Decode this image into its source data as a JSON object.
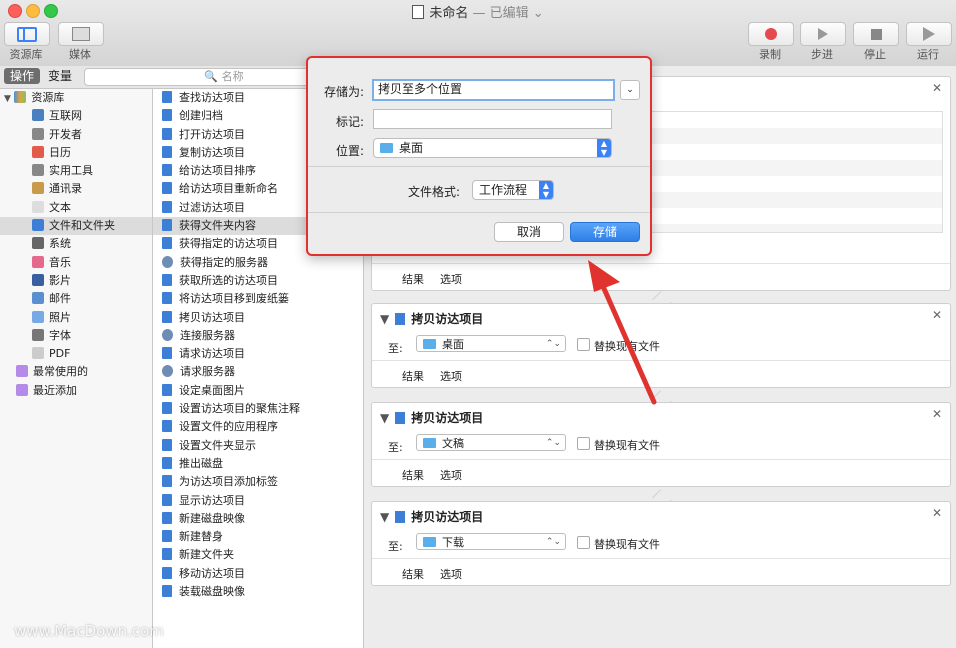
{
  "window": {
    "title": "未命名",
    "subtitle": "— 已编辑 ⌄"
  },
  "toolbar": {
    "library_label": "资源库",
    "media_label": "媒体",
    "record_label": "录制",
    "step_label": "步进",
    "stop_label": "停止",
    "run_label": "运行"
  },
  "tabs": {
    "actions": "操作",
    "variables": "变量",
    "search_placeholder": "名称"
  },
  "library": {
    "root": "资源库",
    "items": [
      "互联网",
      "开发者",
      "日历",
      "实用工具",
      "通讯录",
      "文本",
      "文件和文件夹",
      "系统",
      "音乐",
      "影片",
      "邮件",
      "照片",
      "字体",
      "PDF"
    ],
    "selected_index": 6,
    "smart": [
      "最常使用的",
      "最近添加"
    ]
  },
  "actions": [
    "查找访达项目",
    "创建归档",
    "打开访达项目",
    "复制访达项目",
    "给访达项目排序",
    "给访达项目重新命名",
    "过滤访达项目",
    "获得文件夹内容",
    "获得指定的访达项目",
    "获得指定的服务器",
    "获取所选的访达项目",
    "将访达项目移到废纸篓",
    "拷贝访达项目",
    "连接服务器",
    "请求访达项目",
    "请求服务器",
    "设定桌面图片",
    "设置访达项目的聚焦注释",
    "设置文件的应用程序",
    "设置文件夹显示",
    "推出磁盘",
    "为访达项目添加标签",
    "显示访达项目",
    "新建磁盘映像",
    "新建替身",
    "新建文件夹",
    "移动访达项目",
    "装载磁盘映像"
  ],
  "actions_selected_index": 7,
  "workflow": {
    "card_common": {
      "to_label": "至:",
      "replace_label": "替换现有文件",
      "results": "结果",
      "options": "选项"
    },
    "first_footer": {
      "results": "结果",
      "options": "选项"
    },
    "cards": [
      {
        "title": "拷贝访达项目",
        "destination": "桌面"
      },
      {
        "title": "拷贝访达项目",
        "destination": "文稿"
      },
      {
        "title": "拷贝访达项目",
        "destination": "下载"
      }
    ]
  },
  "dialog": {
    "save_as_label": "存储为:",
    "save_as_value": "拷贝至多个位置",
    "tags_label": "标记:",
    "location_label": "位置:",
    "location_value": "桌面",
    "format_label": "文件格式:",
    "format_value": "工作流程",
    "cancel": "取消",
    "save": "存储"
  },
  "watermark": "www.MacDown.com",
  "colors": {
    "accent": "#2d7fe8",
    "highlight_border": "#e0332f"
  }
}
